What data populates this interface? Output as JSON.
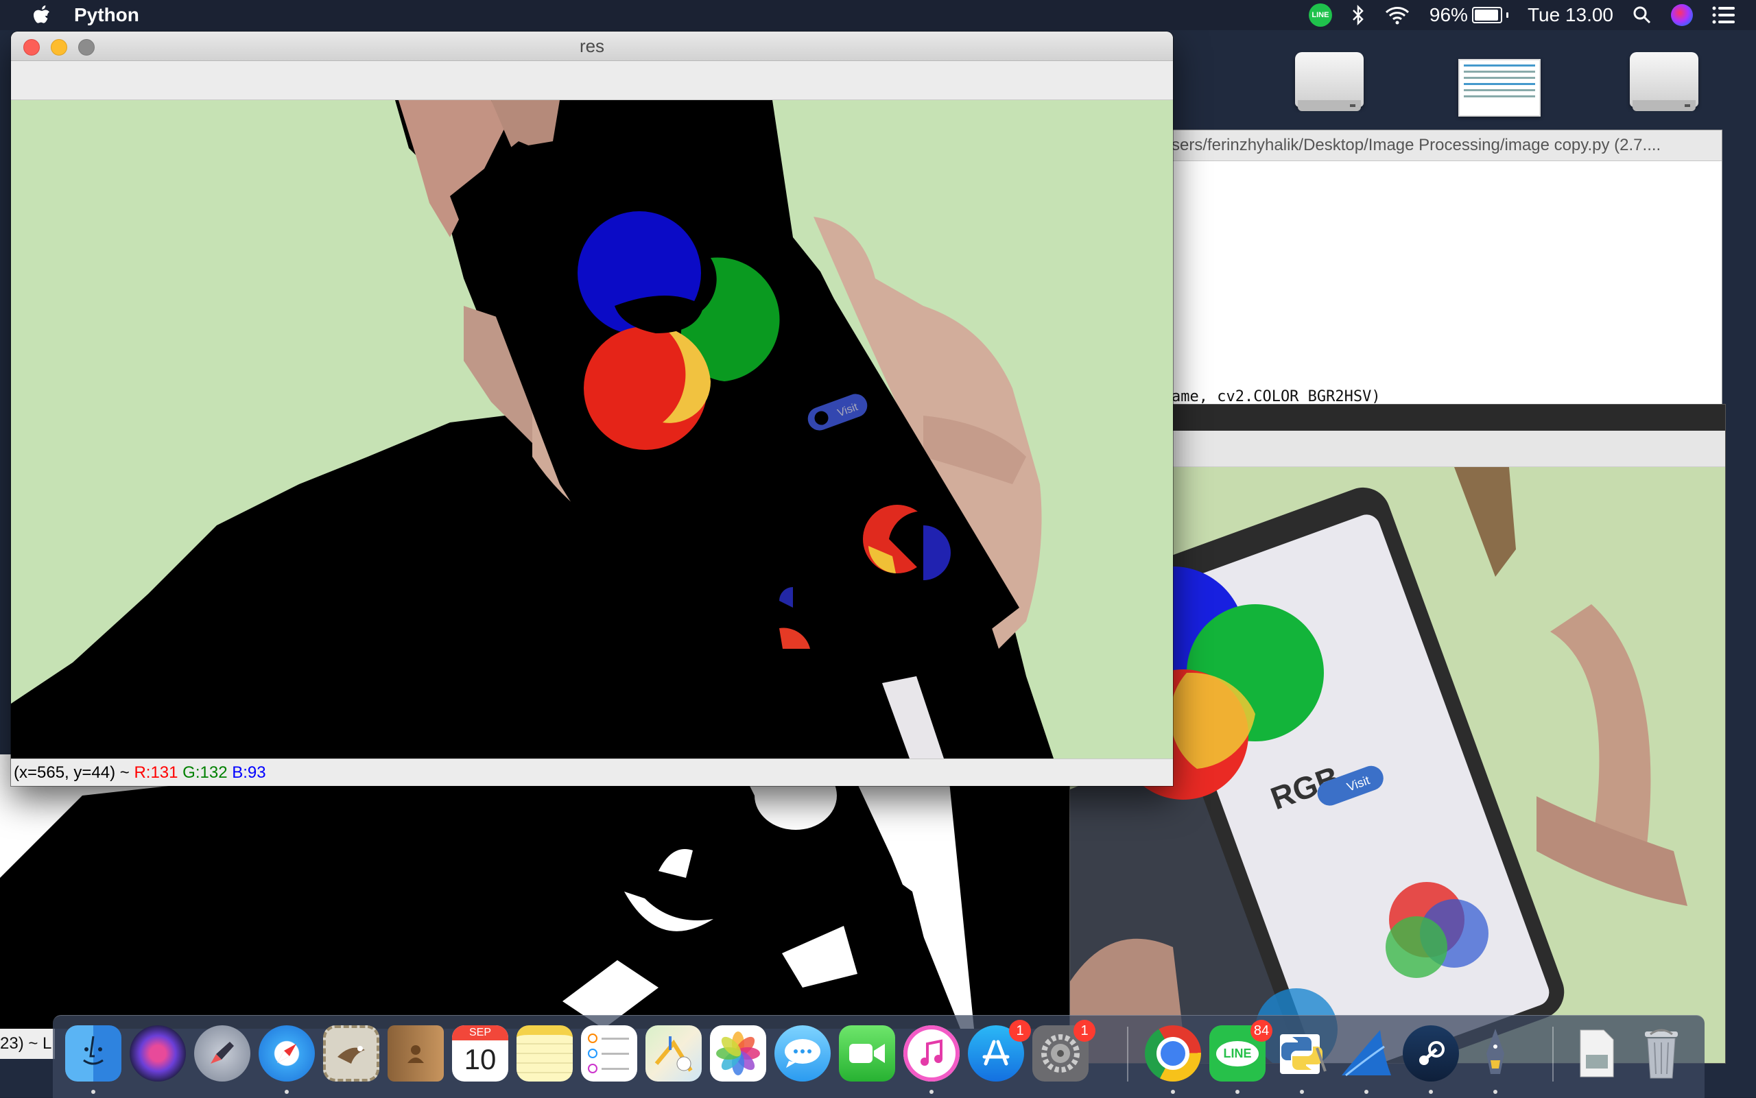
{
  "menubar": {
    "app_name": "Python",
    "line_icon_label": "LINE",
    "battery": "96%",
    "battery_level": 0.96,
    "clock": "Tue 13.00"
  },
  "res_window": {
    "title": "res",
    "status": {
      "coords": "(x=565, y=44) ~ ",
      "r": "R:131",
      "g": "G:132",
      "b": "B:93"
    },
    "colors": {
      "red": "#ff0000",
      "green": "#008000",
      "blue": "#0000ff"
    },
    "phone_button_label": "Visit"
  },
  "editor_window": {
    "title": "sers/ferinzhyhalik/Desktop/Image Processing/image copy.py (2.7....",
    "code_line": "ame, cv2.COLOR_BGR2HSV)"
  },
  "frame_window": {
    "rgb_label": "RGB",
    "visit_label": "Visit"
  },
  "mask_window": {
    "status_text": "23) ~ L"
  },
  "dock": {
    "calendar_month": "SEP",
    "calendar_day": "10",
    "app_store_badge": "1",
    "settings_badge": "1",
    "line_badge": "84",
    "line_label": "LINE"
  }
}
